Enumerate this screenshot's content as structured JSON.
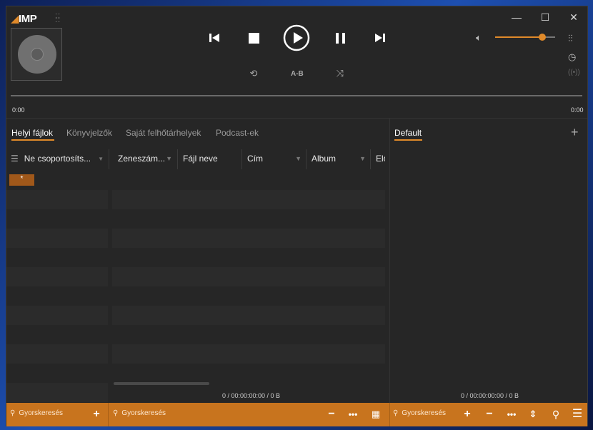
{
  "app": {
    "logo_text": "IMP"
  },
  "transport": {
    "ab_label": "A-B"
  },
  "volume": {
    "level_fraction": 0.78
  },
  "seek": {
    "elapsed": "0:00",
    "remaining": "0:00"
  },
  "tabs": [
    {
      "label": "Helyi fájlok",
      "active": true
    },
    {
      "label": "Könyvjelzők",
      "active": false
    },
    {
      "label": "Saját felhőtárhelyek",
      "active": false
    },
    {
      "label": "Podcast-ek",
      "active": false
    }
  ],
  "playlist_tab": {
    "label": "Default"
  },
  "grouping": {
    "label": "Ne csoportosíts...",
    "badge": "*"
  },
  "columns": [
    {
      "label": "Zeneszám..."
    },
    {
      "label": "Fájl neve"
    },
    {
      "label": "Cím"
    },
    {
      "label": "Album"
    },
    {
      "label": "Elő"
    }
  ],
  "status": {
    "library": "0 / 00:00:00:00 / 0 B",
    "playlist": "0 / 00:00:00:00 / 0 B"
  },
  "bottom": {
    "search_placeholder_1": "Gyorskeresés",
    "search_placeholder_2": "Gyorskeresés",
    "search_placeholder_3": "Gyorskeresés"
  },
  "colors": {
    "accent": "#e08a2a",
    "bar": "#c8741e",
    "bg": "#262626"
  }
}
